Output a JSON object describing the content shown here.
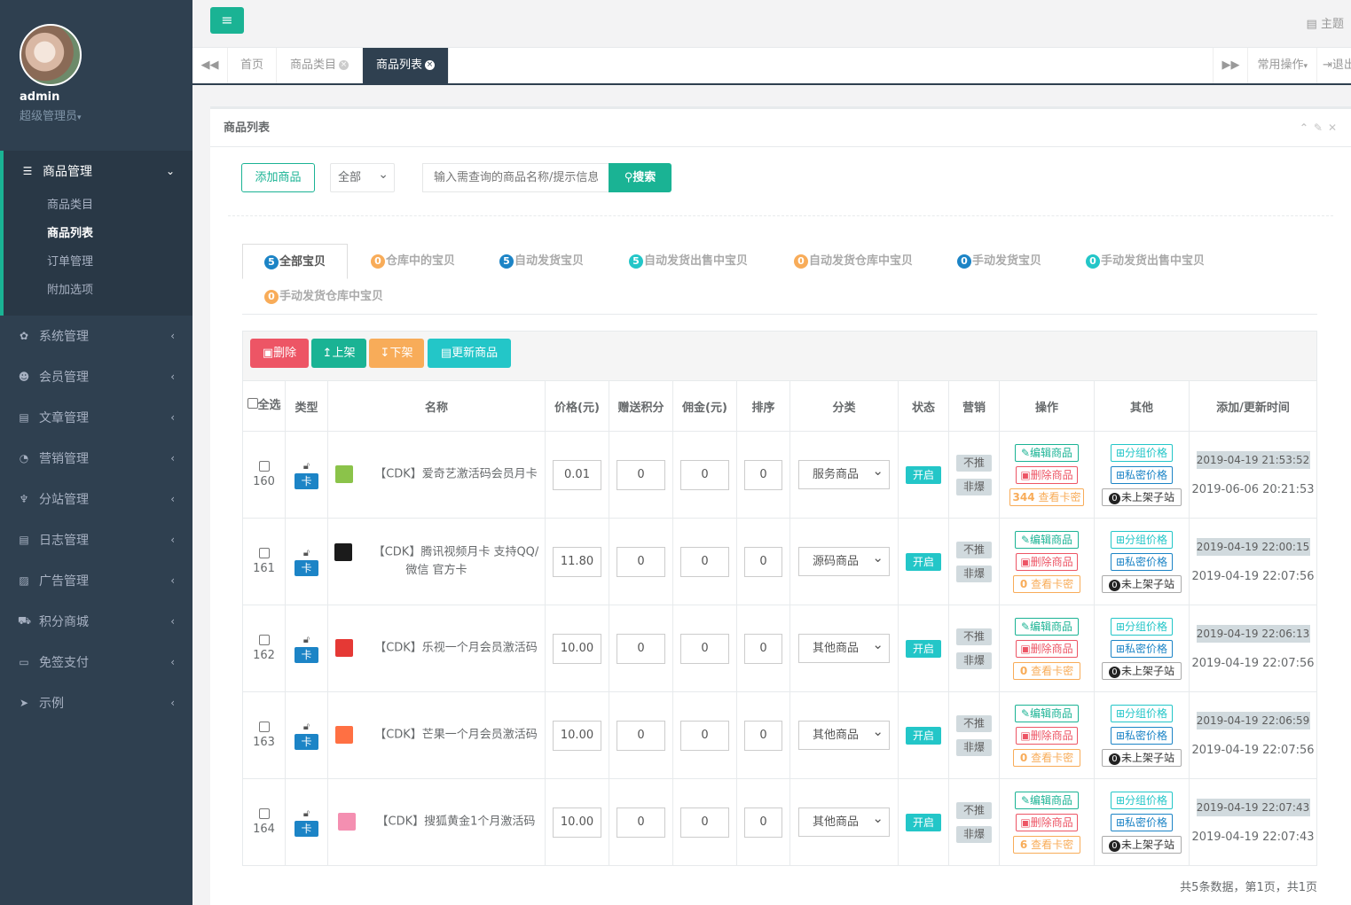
{
  "sidebar": {
    "username": "admin",
    "role": "超级管理员",
    "groups": [
      {
        "label": "商品管理",
        "icon": "list-icon"
      },
      {
        "label": "系统管理",
        "icon": "gear-icon"
      },
      {
        "label": "会员管理",
        "icon": "users-icon"
      },
      {
        "label": "文章管理",
        "icon": "article-icon"
      },
      {
        "label": "营销管理",
        "icon": "pie-icon"
      },
      {
        "label": "分站管理",
        "icon": "pin-icon"
      },
      {
        "label": "日志管理",
        "icon": "log-icon"
      },
      {
        "label": "广告管理",
        "icon": "image-icon"
      },
      {
        "label": "积分商城",
        "icon": "cart-icon"
      },
      {
        "label": "免签支付",
        "icon": "card-icon"
      },
      {
        "label": "示例",
        "icon": "paper-plane-icon"
      }
    ],
    "sub_items": [
      "商品类目",
      "商品列表",
      "订单管理",
      "附加选项"
    ]
  },
  "topbar": {
    "theme": "主题"
  },
  "tabs": {
    "home": "首页",
    "category": "商品类目",
    "list": "商品列表",
    "ops": "常用操作",
    "logout": "退出"
  },
  "panel": {
    "title": "商品列表",
    "add_button": "添加商品",
    "filter_select": "全部",
    "search_placeholder": "输入需查询的商品名称/提示信息",
    "search_button": "搜索"
  },
  "filter_tabs": [
    {
      "count": "5",
      "label": "全部宝贝"
    },
    {
      "count": "0",
      "label": "仓库中的宝贝"
    },
    {
      "count": "5",
      "label": "自动发货宝贝"
    },
    {
      "count": "5",
      "label": "自动发货出售中宝贝"
    },
    {
      "count": "0",
      "label": "自动发货仓库中宝贝"
    },
    {
      "count": "0",
      "label": "手动发货宝贝"
    },
    {
      "count": "0",
      "label": "手动发货出售中宝贝"
    },
    {
      "count": "0",
      "label": "手动发货仓库中宝贝"
    }
  ],
  "toolbar": {
    "delete": "删除",
    "up": "上架",
    "down": "下架",
    "update": "更新商品"
  },
  "columns": {
    "select": "全选",
    "type": "类型",
    "name": "名称",
    "price": "价格(元)",
    "points": "赠送积分",
    "commission": "佣金(元)",
    "sort": "排序",
    "category": "分类",
    "status": "状态",
    "marketing": "营销",
    "ops": "操作",
    "other": "其他",
    "time": "添加/更新时间"
  },
  "labels": {
    "card": "卡",
    "open": "开启",
    "not_push": "不推",
    "not_hot": "非爆",
    "edit": "编辑商品",
    "delete": "删除商品",
    "view_keys": "查看卡密",
    "group_price": "分组价格",
    "private_price": "私密价格",
    "not_listed": "未上架子站",
    "not_listed_count": "0"
  },
  "rows": [
    {
      "id": "160",
      "name": "【CDK】爱奇艺激活码会员月卡",
      "price": "0.01",
      "points": "0",
      "commission": "0",
      "sort": "0",
      "category": "服务商品",
      "keys": "344",
      "created": "2019-04-19 21:53:52",
      "updated": "2019-06-06 20:21:53",
      "thumb_color": "#8bc34a"
    },
    {
      "id": "161",
      "name": "【CDK】腾讯视频月卡 支持QQ/微信 官方卡",
      "price": "11.80",
      "points": "0",
      "commission": "0",
      "sort": "0",
      "category": "源码商品",
      "keys": "0",
      "created": "2019-04-19 22:00:15",
      "updated": "2019-04-19 22:07:56",
      "thumb_color": "#1b1b1b"
    },
    {
      "id": "162",
      "name": "【CDK】乐视一个月会员激活码",
      "price": "10.00",
      "points": "0",
      "commission": "0",
      "sort": "0",
      "category": "其他商品",
      "keys": "0",
      "created": "2019-04-19 22:06:13",
      "updated": "2019-04-19 22:07:56",
      "thumb_color": "#e53935"
    },
    {
      "id": "163",
      "name": "【CDK】芒果一个月会员激活码",
      "price": "10.00",
      "points": "0",
      "commission": "0",
      "sort": "0",
      "category": "其他商品",
      "keys": "0",
      "created": "2019-04-19 22:06:59",
      "updated": "2019-04-19 22:07:56",
      "thumb_color": "#ff7043"
    },
    {
      "id": "164",
      "name": "【CDK】搜狐黄金1个月激活码",
      "price": "10.00",
      "points": "0",
      "commission": "0",
      "sort": "0",
      "category": "其他商品",
      "keys": "6",
      "created": "2019-04-19 22:07:43",
      "updated": "2019-04-19 22:07:43",
      "thumb_color": "#f48fb1"
    }
  ],
  "footer": "共5条数据，第1页，共1页"
}
